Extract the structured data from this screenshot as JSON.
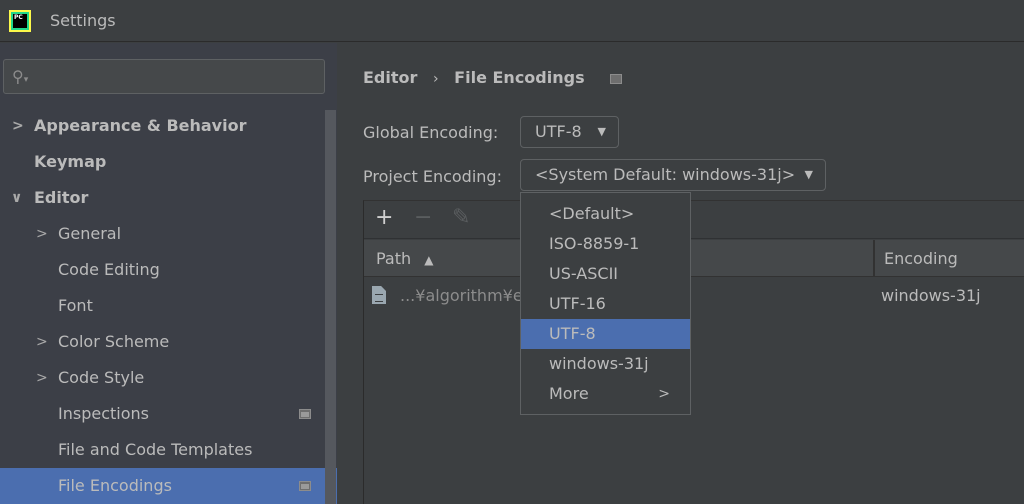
{
  "window": {
    "title": "Settings",
    "app_icon": "pycharm-logo-icon",
    "app_icon_text": "PC"
  },
  "search": {
    "value": "",
    "placeholder": "",
    "icon": "search-icon"
  },
  "sidebar": {
    "items": [
      {
        "label": "Appearance & Behavior",
        "level": 0,
        "expandable": true,
        "expanded": false,
        "bold": true
      },
      {
        "label": "Keymap",
        "level": 0,
        "expandable": false,
        "bold": true
      },
      {
        "label": "Editor",
        "level": 0,
        "expandable": true,
        "expanded": true,
        "bold": true
      },
      {
        "label": "General",
        "level": 1,
        "expandable": true,
        "expanded": false
      },
      {
        "label": "Code Editing",
        "level": 1,
        "expandable": false
      },
      {
        "label": "Font",
        "level": 1,
        "expandable": false
      },
      {
        "label": "Color Scheme",
        "level": 1,
        "expandable": true,
        "expanded": false
      },
      {
        "label": "Code Style",
        "level": 1,
        "expandable": true,
        "expanded": false
      },
      {
        "label": "Inspections",
        "level": 1,
        "expandable": false,
        "project_scope": true
      },
      {
        "label": "File and Code Templates",
        "level": 1,
        "expandable": false
      },
      {
        "label": "File Encodings",
        "level": 1,
        "expandable": false,
        "project_scope": true,
        "selected": true
      }
    ]
  },
  "breadcrumb": {
    "parent": "Editor",
    "separator": "›",
    "current": "File Encodings"
  },
  "form": {
    "global_encoding_label": "Global Encoding:",
    "global_encoding_value": "UTF-8",
    "project_encoding_label": "Project Encoding:",
    "project_encoding_value": "<System Default: windows-31j>"
  },
  "toolbar": {
    "add": "+",
    "remove": "−",
    "edit": "✎"
  },
  "table": {
    "columns": [
      {
        "label": "Path",
        "sort": "ascending"
      },
      {
        "label": "Encoding"
      }
    ],
    "rows": [
      {
        "path": "...¥algorithm¥ev",
        "encoding": "windows-31j"
      }
    ]
  },
  "dropdown": {
    "options": [
      "<Default>",
      "ISO-8859-1",
      "US-ASCII",
      "UTF-16",
      "UTF-8",
      "windows-31j",
      "More"
    ],
    "selected": "UTF-8",
    "submenu_option": "More"
  },
  "colors": {
    "selection": "#4b6eaf",
    "background": "#3c3f41",
    "sidebar_bg": "#3c3f47",
    "text": "#bbbbbb"
  }
}
